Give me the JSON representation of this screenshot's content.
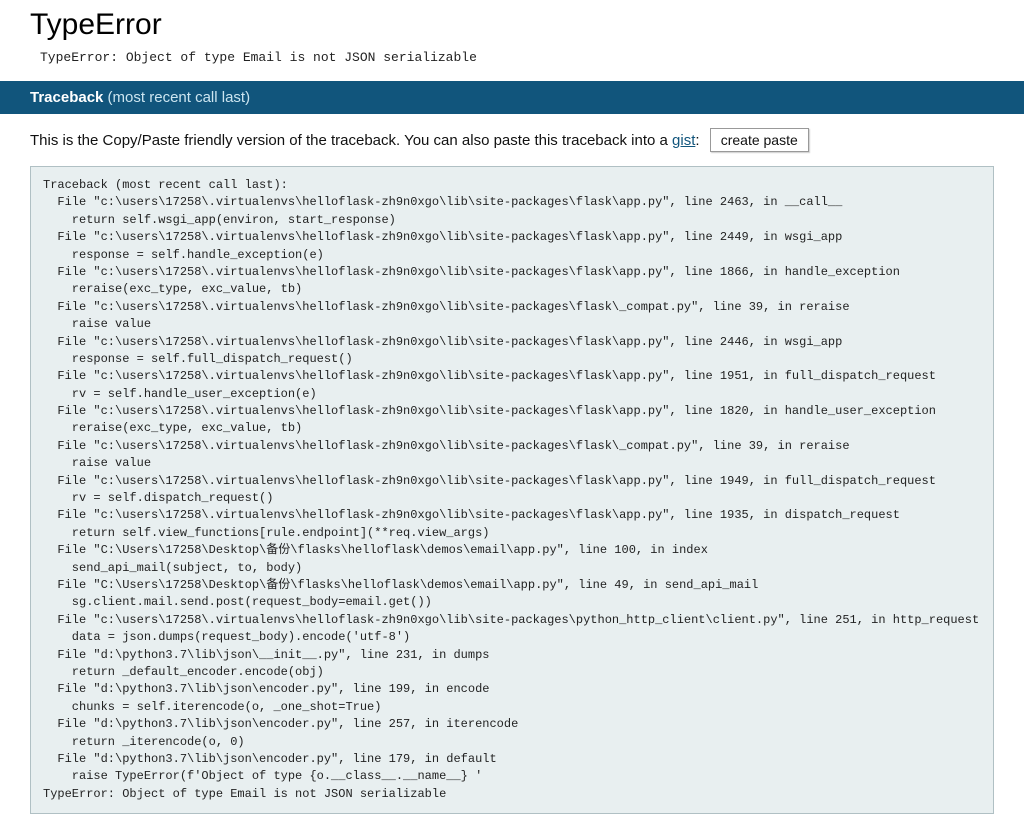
{
  "title": "TypeError",
  "message": "TypeError: Object of type Email is not JSON serializable",
  "traceback_header_strong": "Traceback",
  "traceback_header_em": " (most recent call last)",
  "description_prefix": "This is the Copy/Paste friendly version of the traceback. You can also paste this traceback into a ",
  "gist_label": "gist",
  "description_suffix": ":",
  "create_paste_label": "create paste",
  "traceback_text": "Traceback (most recent call last):\n  File \"c:\\users\\17258\\.virtualenvs\\helloflask-zh9n0xgo\\lib\\site-packages\\flask\\app.py\", line 2463, in __call__\n    return self.wsgi_app(environ, start_response)\n  File \"c:\\users\\17258\\.virtualenvs\\helloflask-zh9n0xgo\\lib\\site-packages\\flask\\app.py\", line 2449, in wsgi_app\n    response = self.handle_exception(e)\n  File \"c:\\users\\17258\\.virtualenvs\\helloflask-zh9n0xgo\\lib\\site-packages\\flask\\app.py\", line 1866, in handle_exception\n    reraise(exc_type, exc_value, tb)\n  File \"c:\\users\\17258\\.virtualenvs\\helloflask-zh9n0xgo\\lib\\site-packages\\flask\\_compat.py\", line 39, in reraise\n    raise value\n  File \"c:\\users\\17258\\.virtualenvs\\helloflask-zh9n0xgo\\lib\\site-packages\\flask\\app.py\", line 2446, in wsgi_app\n    response = self.full_dispatch_request()\n  File \"c:\\users\\17258\\.virtualenvs\\helloflask-zh9n0xgo\\lib\\site-packages\\flask\\app.py\", line 1951, in full_dispatch_request\n    rv = self.handle_user_exception(e)\n  File \"c:\\users\\17258\\.virtualenvs\\helloflask-zh9n0xgo\\lib\\site-packages\\flask\\app.py\", line 1820, in handle_user_exception\n    reraise(exc_type, exc_value, tb)\n  File \"c:\\users\\17258\\.virtualenvs\\helloflask-zh9n0xgo\\lib\\site-packages\\flask\\_compat.py\", line 39, in reraise\n    raise value\n  File \"c:\\users\\17258\\.virtualenvs\\helloflask-zh9n0xgo\\lib\\site-packages\\flask\\app.py\", line 1949, in full_dispatch_request\n    rv = self.dispatch_request()\n  File \"c:\\users\\17258\\.virtualenvs\\helloflask-zh9n0xgo\\lib\\site-packages\\flask\\app.py\", line 1935, in dispatch_request\n    return self.view_functions[rule.endpoint](**req.view_args)\n  File \"C:\\Users\\17258\\Desktop\\备份\\flasks\\helloflask\\demos\\email\\app.py\", line 100, in index\n    send_api_mail(subject, to, body)\n  File \"C:\\Users\\17258\\Desktop\\备份\\flasks\\helloflask\\demos\\email\\app.py\", line 49, in send_api_mail\n    sg.client.mail.send.post(request_body=email.get())\n  File \"c:\\users\\17258\\.virtualenvs\\helloflask-zh9n0xgo\\lib\\site-packages\\python_http_client\\client.py\", line 251, in http_request\n    data = json.dumps(request_body).encode('utf-8')\n  File \"d:\\python3.7\\lib\\json\\__init__.py\", line 231, in dumps\n    return _default_encoder.encode(obj)\n  File \"d:\\python3.7\\lib\\json\\encoder.py\", line 199, in encode\n    chunks = self.iterencode(o, _one_shot=True)\n  File \"d:\\python3.7\\lib\\json\\encoder.py\", line 257, in iterencode\n    return _iterencode(o, 0)\n  File \"d:\\python3.7\\lib\\json\\encoder.py\", line 179, in default\n    raise TypeError(f'Object of type {o.__class__.__name__} '\nTypeError: Object of type Email is not JSON serializable"
}
